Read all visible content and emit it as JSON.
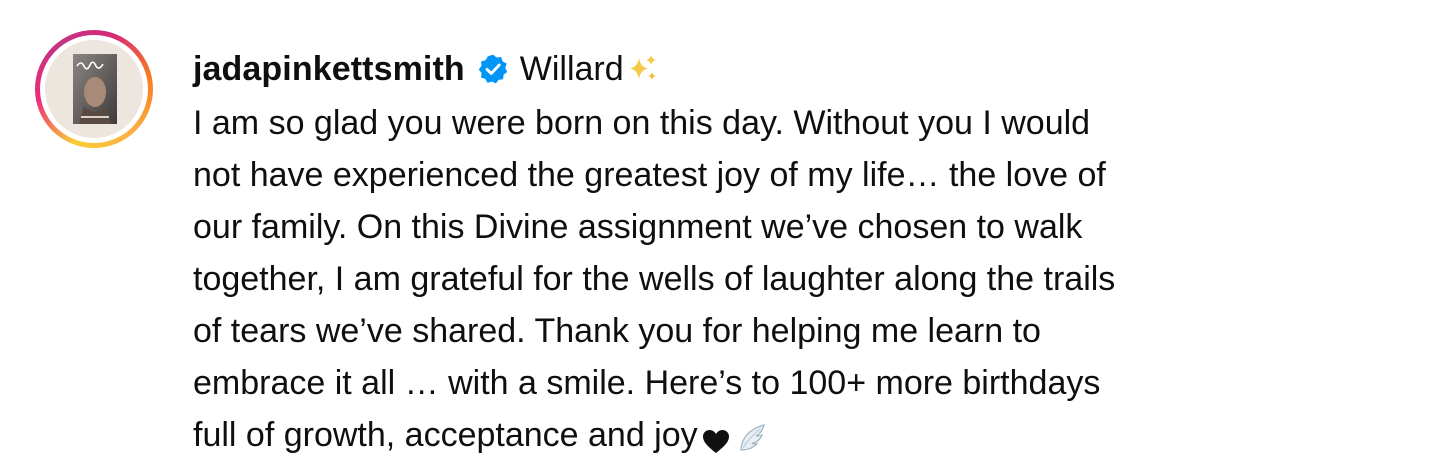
{
  "post": {
    "username": "jadapinkettsmith",
    "verified_icon": "verified-badge-icon",
    "header_text": "Willard",
    "header_emoji": "sparkles-icon",
    "caption_lines": [
      "I am so glad you were born on this day. Without you I would",
      "not have experienced the greatest joy of my life… the love of",
      "our family. On this Divine assignment we’ve chosen to walk",
      "together, I am grateful for the wells of laughter along the trails",
      "of tears we’ve shared. Thank you for helping me learn to",
      "embrace it all … with a smile. Here’s to 100+ more birthdays",
      "full of growth, acceptance and joy"
    ],
    "end_emojis": [
      "black-heart-icon",
      "wing-icon"
    ]
  },
  "colors": {
    "text": "#0f0f0f",
    "verified": "#0095f6",
    "ring_gradient": [
      "#f9ce34",
      "#ee2a7b",
      "#6228d7"
    ]
  }
}
